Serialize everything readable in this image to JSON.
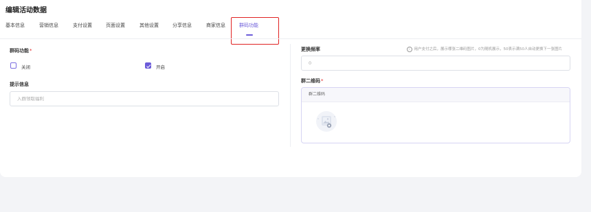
{
  "page": {
    "title": "编辑活动数据"
  },
  "tabs": [
    {
      "label": "基本信息"
    },
    {
      "label": "营销信息"
    },
    {
      "label": "支付设置"
    },
    {
      "label": "页面设置"
    },
    {
      "label": "其他设置"
    },
    {
      "label": "分享信息"
    },
    {
      "label": "商家信息"
    },
    {
      "label": "群码功能",
      "active": true
    }
  ],
  "left": {
    "group_code_label": "群码功能",
    "required_mark": "*",
    "options": [
      {
        "label": "关闭",
        "checked": false
      },
      {
        "label": "开启",
        "checked": true
      }
    ],
    "prompt_label": "提示信息",
    "prompt_value": "入群领取福利"
  },
  "right": {
    "frequency_label": "更换频率",
    "frequency_hint": "用户支付之后，展示哪张二维码图片，0为随机展示，50表示满50人自动更换下一张图片",
    "frequency_value": "0",
    "qr_label": "群二维码",
    "required_mark": "*",
    "qr_header": "群二维码"
  },
  "colors": {
    "accent": "#6b5bd9",
    "highlight": "#e02020"
  }
}
